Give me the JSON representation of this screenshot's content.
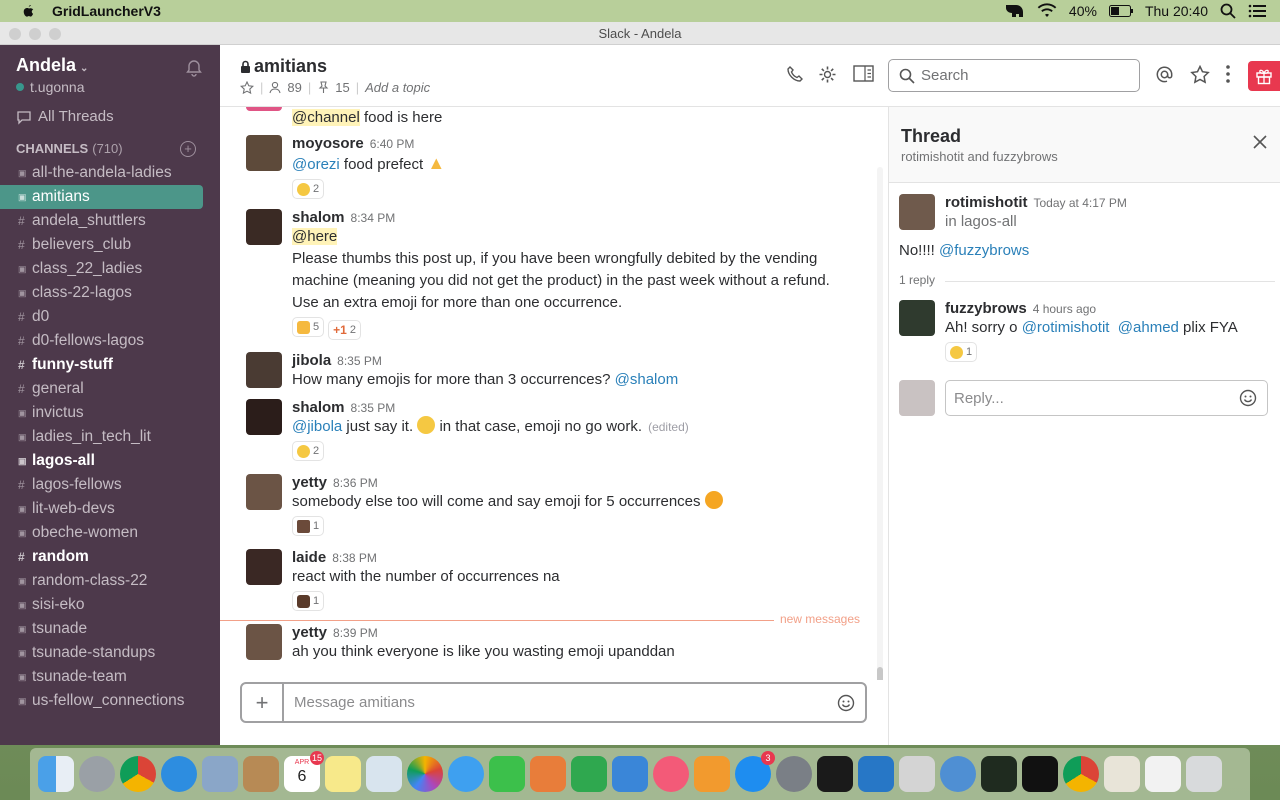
{
  "menubar": {
    "app_name": "GridLauncherV3",
    "battery": "40%",
    "clock": "Thu 20:40"
  },
  "window": {
    "title": "Slack - Andela"
  },
  "sidebar": {
    "team_name": "Andela",
    "username": "t.ugonna",
    "all_threads": "All Threads",
    "channels_label": "CHANNELS",
    "channels_count": "(710)",
    "channels": [
      {
        "name": "all-the-andela-ladies",
        "private": true,
        "active": false,
        "bold": false
      },
      {
        "name": "amitians",
        "private": true,
        "active": true,
        "bold": false
      },
      {
        "name": "andela_shuttlers",
        "private": false,
        "active": false,
        "bold": false
      },
      {
        "name": "believers_club",
        "private": false,
        "active": false,
        "bold": false
      },
      {
        "name": "class_22_ladies",
        "private": true,
        "active": false,
        "bold": false
      },
      {
        "name": "class-22-lagos",
        "private": true,
        "active": false,
        "bold": false
      },
      {
        "name": "d0",
        "private": false,
        "active": false,
        "bold": false
      },
      {
        "name": "d0-fellows-lagos",
        "private": false,
        "active": false,
        "bold": false
      },
      {
        "name": "funny-stuff",
        "private": false,
        "active": false,
        "bold": true
      },
      {
        "name": "general",
        "private": false,
        "active": false,
        "bold": false
      },
      {
        "name": "invictus",
        "private": true,
        "active": false,
        "bold": false
      },
      {
        "name": "ladies_in_tech_lit",
        "private": true,
        "active": false,
        "bold": false
      },
      {
        "name": "lagos-all",
        "private": true,
        "active": false,
        "bold": true
      },
      {
        "name": "lagos-fellows",
        "private": false,
        "active": false,
        "bold": false
      },
      {
        "name": "lit-web-devs",
        "private": true,
        "active": false,
        "bold": false
      },
      {
        "name": "obeche-women",
        "private": true,
        "active": false,
        "bold": false
      },
      {
        "name": "random",
        "private": false,
        "active": false,
        "bold": true
      },
      {
        "name": "random-class-22",
        "private": true,
        "active": false,
        "bold": false
      },
      {
        "name": "sisi-eko",
        "private": true,
        "active": false,
        "bold": false
      },
      {
        "name": "tsunade",
        "private": true,
        "active": false,
        "bold": false
      },
      {
        "name": "tsunade-standups",
        "private": true,
        "active": false,
        "bold": false
      },
      {
        "name": "tsunade-team",
        "private": true,
        "active": false,
        "bold": false
      },
      {
        "name": "us-fellow_connections",
        "private": true,
        "active": false,
        "bold": false
      }
    ]
  },
  "header": {
    "channel": "amitians",
    "members": "89",
    "pins": "15",
    "topic": "Add a topic",
    "search_placeholder": "Search"
  },
  "messages": [
    {
      "mention": "@channel",
      "text": " food is here"
    },
    {
      "author": "moyosore",
      "time": "6:40 PM",
      "link": "@orezi",
      "text": " food prefect",
      "react_count": "2"
    },
    {
      "author": "shalom",
      "time": "8:34 PM",
      "mention": "@here",
      "lines": [
        "Please thumbs this post up, if you have been wrongfully debited by the vending",
        "machine (meaning you did not get the product) in the past week without a refund.",
        "Use an extra emoji for more than one occurrence."
      ],
      "react1": "5",
      "react2": "2"
    },
    {
      "author": "jibola",
      "time": "8:35 PM",
      "text": "How many emojis for more than 3 occurrences? ",
      "link": "@shalom"
    },
    {
      "author": "shalom",
      "time": "8:35 PM",
      "link": "@jibola",
      "text1": " just say it.",
      "text2": " in that case, emoji no go work.",
      "edited": "(edited)",
      "react_count": "2"
    },
    {
      "author": "yetty",
      "time": "8:36 PM",
      "text": "somebody else too will come and say emoji for 5 occurrences",
      "react_count": "1"
    },
    {
      "author": "laide",
      "time": "8:38 PM",
      "text": "react with the number of occurrences na",
      "react_count": "1"
    },
    {
      "author": "yetty",
      "time": "8:39 PM",
      "text": "ah you think everyone is like you wasting emoji upanddan"
    }
  ],
  "new_messages": "new messages",
  "composer": {
    "placeholder": "Message amitians"
  },
  "thread": {
    "title": "Thread",
    "subtitle": "rotimishotit and fuzzybrows",
    "parent": {
      "author": "rotimishotit",
      "time": "Today at 4:17 PM",
      "channel": "in lagos-all",
      "text": "No!!!! ",
      "link": "@fuzzybrows"
    },
    "reply_count": "1 reply",
    "reply": {
      "author": "fuzzybrows",
      "time": "4 hours ago",
      "text1": "Ah! sorry o ",
      "link1": "@rotimishotit",
      "link2": "@ahmed",
      "text2": " plix FYA",
      "react_count": "1"
    },
    "reply_placeholder": "Reply..."
  },
  "dock": {
    "calendar_month": "APR",
    "calendar_day": "6",
    "calendar_badge": "15",
    "appstore_badge": "3"
  },
  "colors": {
    "sidebar": "#4d394b",
    "active": "#4c9689",
    "link": "#2a80b9",
    "gift": "#e8384f"
  }
}
